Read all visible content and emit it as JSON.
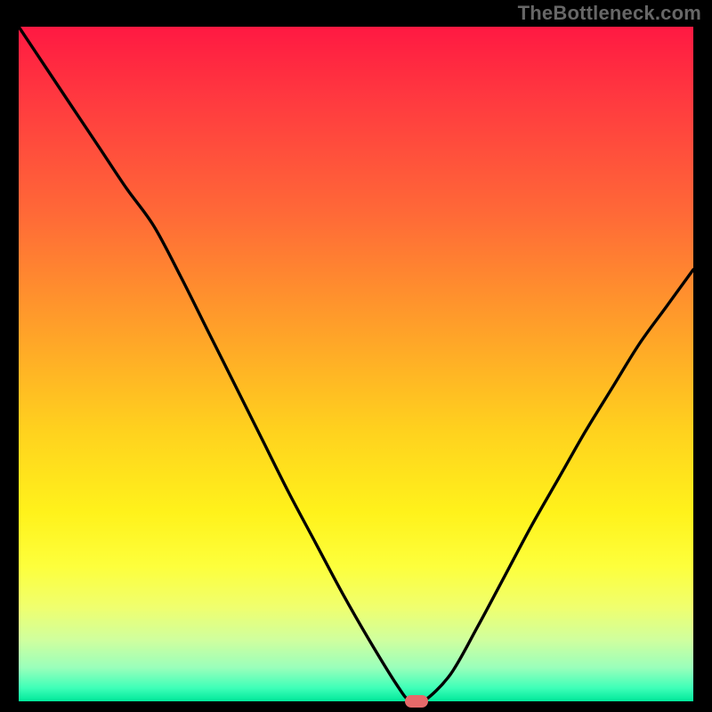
{
  "attribution": "TheBottleneck.com",
  "colors": {
    "frame_bg": "#000000",
    "gradient_top": "#ff1942",
    "gradient_bottom": "#00e89a",
    "curve_stroke": "#000000",
    "marker_fill": "#e66a6a",
    "attribution_text": "#676767"
  },
  "chart_data": {
    "type": "line",
    "title": "",
    "xlabel": "",
    "ylabel": "",
    "xlim": [
      0,
      100
    ],
    "ylim": [
      0,
      100
    ],
    "x": [
      0,
      4,
      8,
      12,
      16,
      20,
      24,
      28,
      32,
      36,
      40,
      44,
      48,
      52,
      56,
      58,
      60,
      64,
      68,
      72,
      76,
      80,
      84,
      88,
      92,
      96,
      100
    ],
    "values": [
      100,
      94,
      88,
      82,
      76,
      70.5,
      63,
      55,
      47,
      39,
      31,
      23.5,
      16,
      9,
      2.5,
      0,
      0,
      4,
      11,
      18.5,
      26,
      33,
      40,
      46.5,
      53,
      58.5,
      64
    ],
    "marker": {
      "x": 59,
      "y": 0
    },
    "grid": false
  }
}
